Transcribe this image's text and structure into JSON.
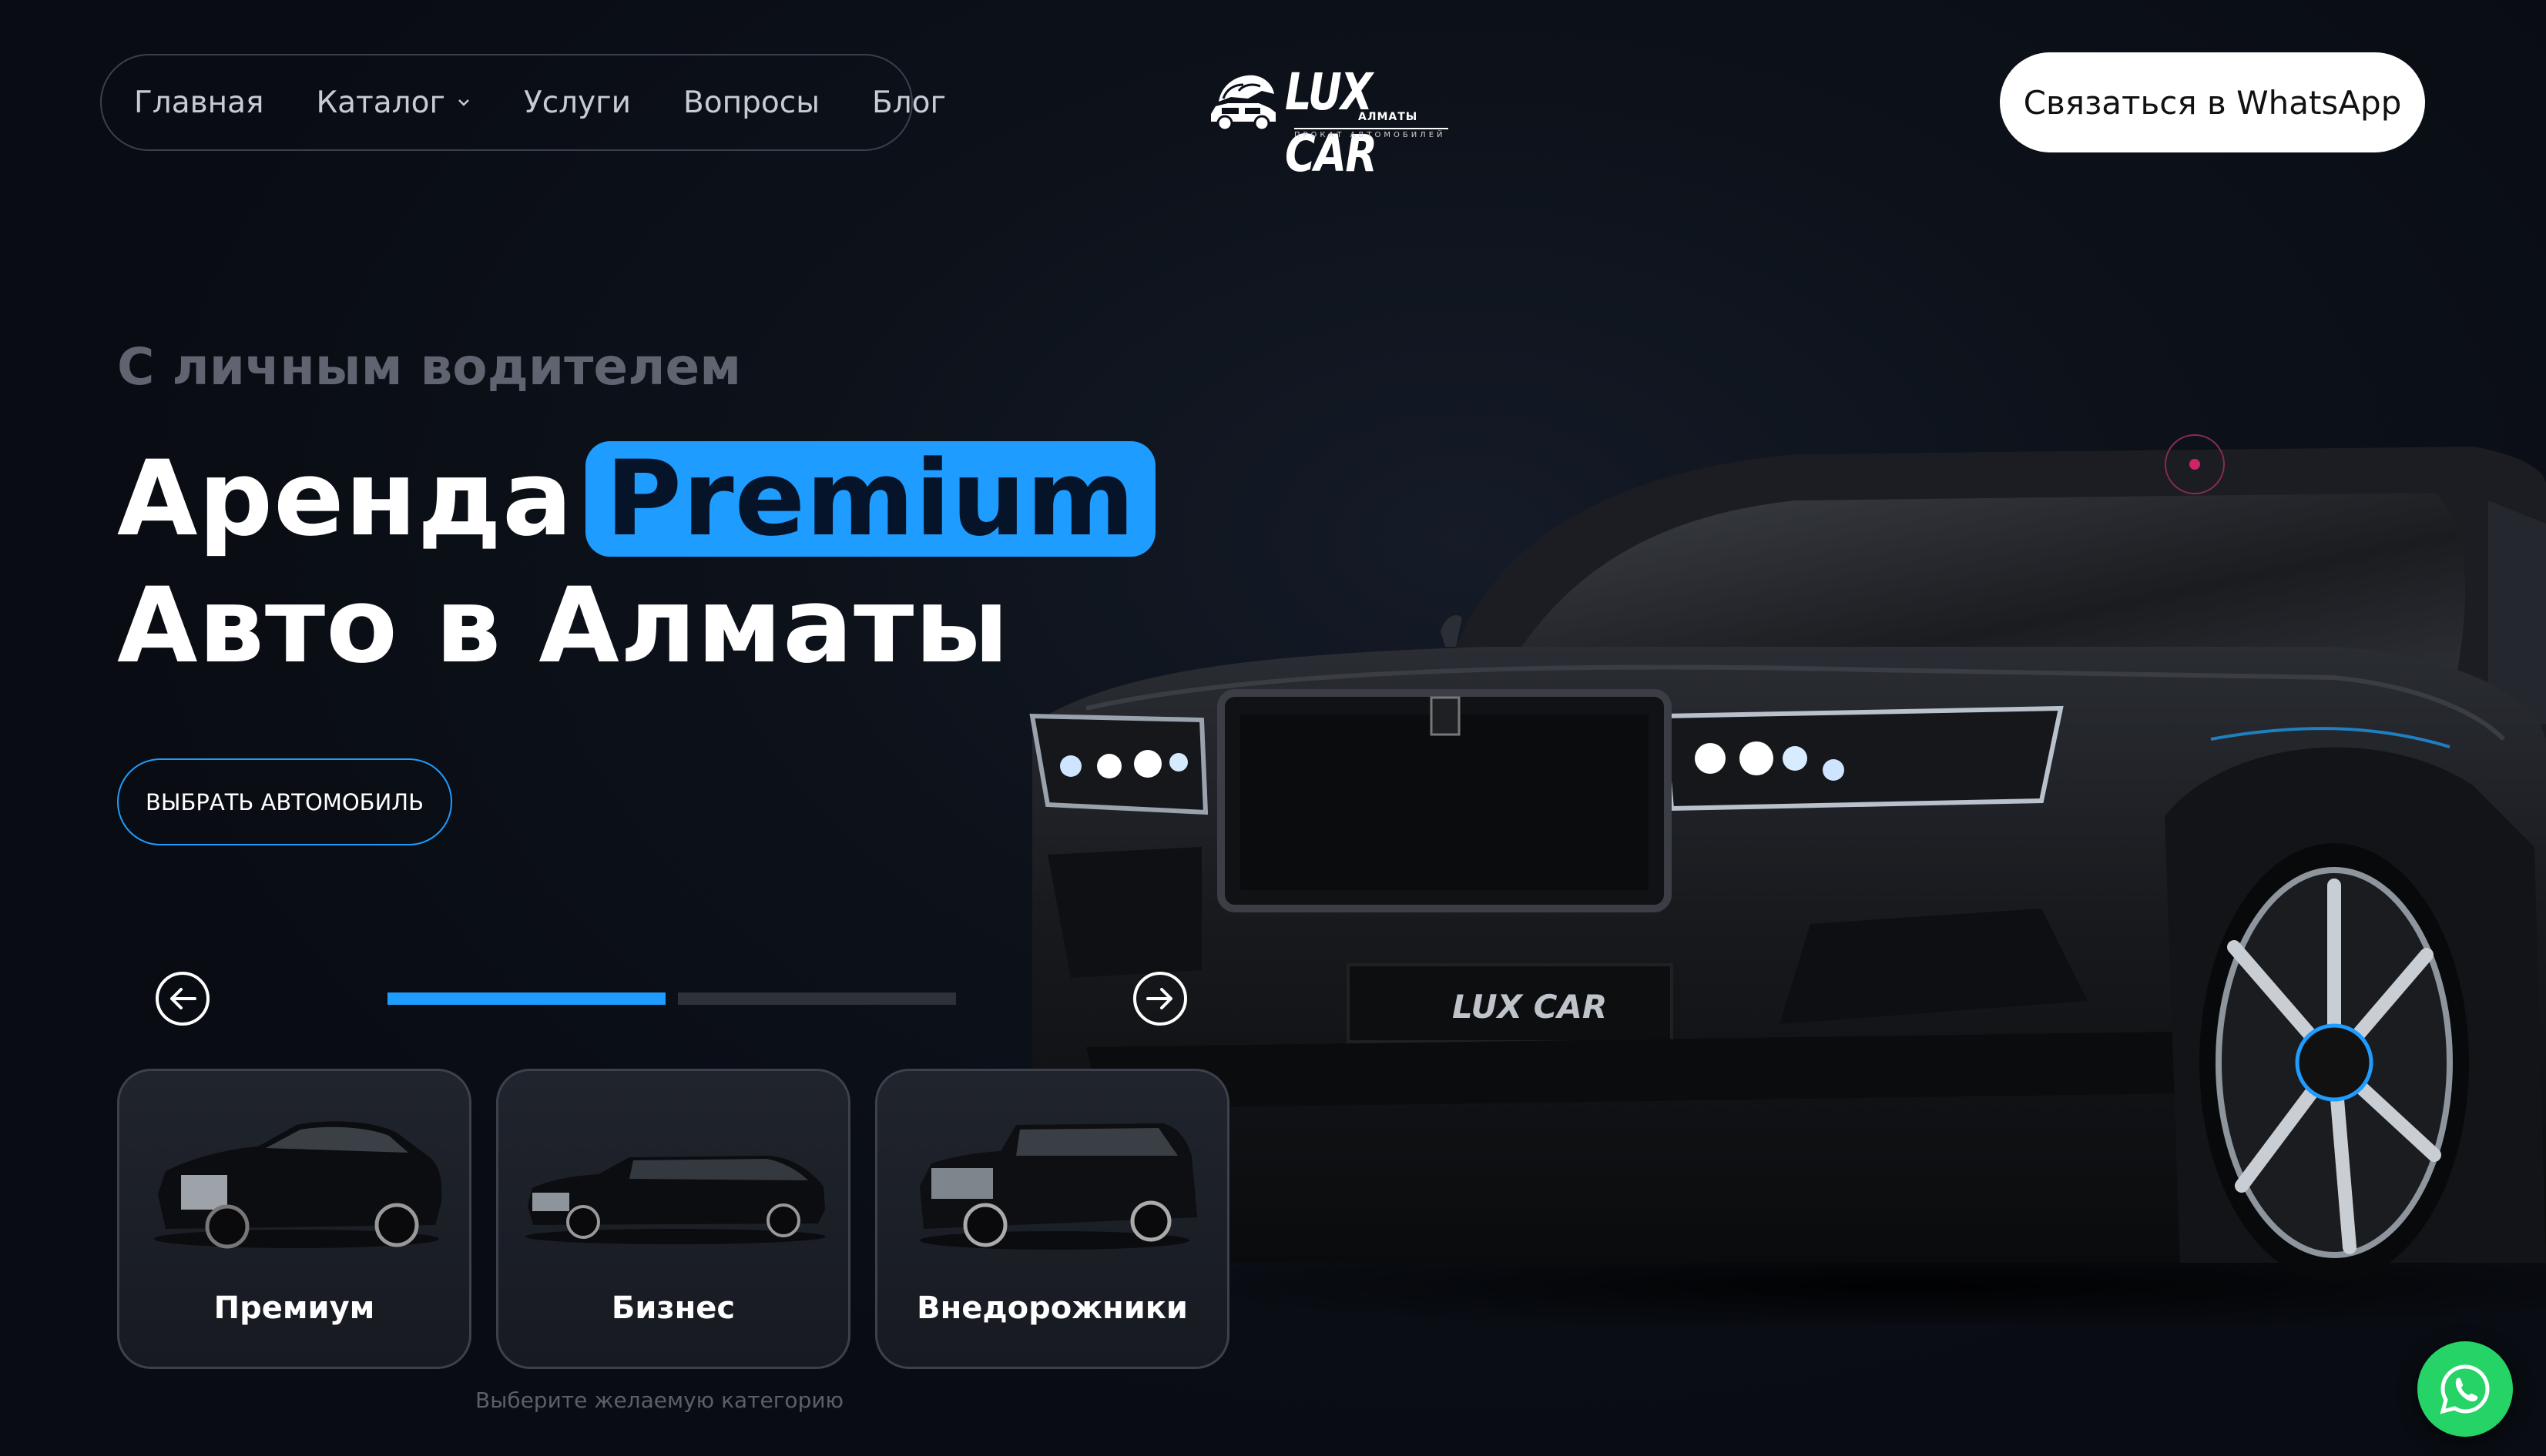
{
  "nav": {
    "items": [
      {
        "label": "Главная"
      },
      {
        "label": "Каталог"
      },
      {
        "label": "Услуги"
      },
      {
        "label": "Вопросы"
      },
      {
        "label": "Блог"
      }
    ]
  },
  "logo": {
    "text": "LUX CAR",
    "city": "АЛМАТЫ",
    "tagline": "ПРОКАТ АВТОМОБИЛЕЙ"
  },
  "header": {
    "cta_label": "Связаться в WhatsApp"
  },
  "hero": {
    "subtitle": "С личным водителем",
    "title_word1": "Аренда",
    "title_highlight": "Premium",
    "title_line2": "Авто в Алматы",
    "button_label": "ВЫБРАТЬ АВТОМОБИЛЬ",
    "grille_badge": "LUX CAR"
  },
  "slider": {
    "segments": 2,
    "active_index": 0
  },
  "categories": [
    {
      "label": "Премиум"
    },
    {
      "label": "Бизнес"
    },
    {
      "label": "Внедорожники"
    }
  ],
  "categories_hint": "Выберите желаемую категорию",
  "colors": {
    "accent": "#1e9cff",
    "background": "#0b0f17",
    "whatsapp": "#25d366",
    "hotspot": "#d0246a"
  },
  "icons": {
    "prev": "arrow-left-circle-icon",
    "next": "arrow-right-circle-icon",
    "catalog_dropdown": "chevron-down-icon",
    "floating": "whatsapp-icon"
  }
}
